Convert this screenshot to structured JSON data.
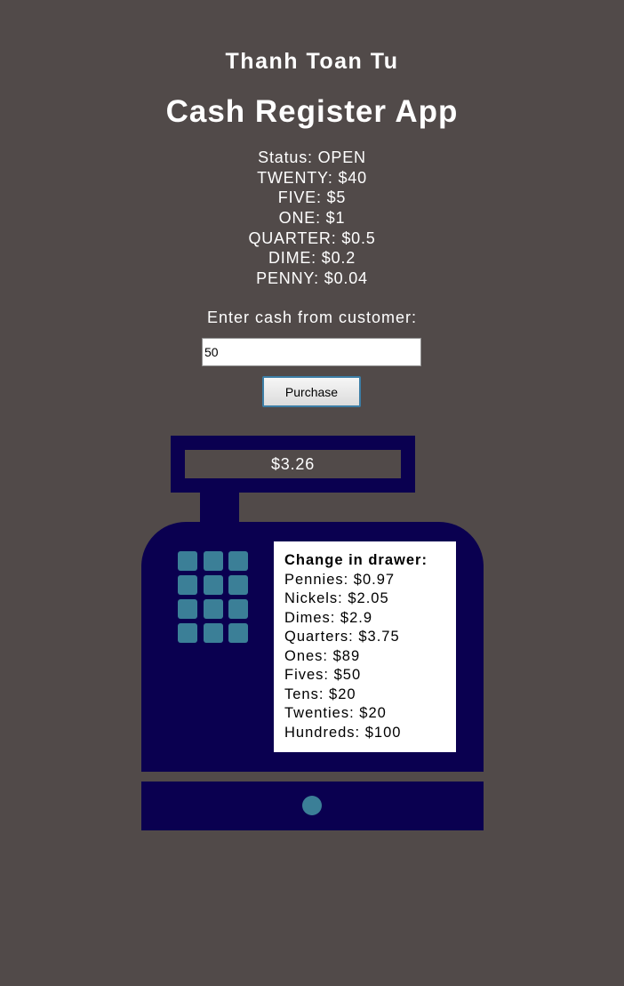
{
  "header": {
    "author": "Thanh Toan Tu",
    "title": "Cash Register App"
  },
  "status": {
    "lines": [
      "Status: OPEN",
      "TWENTY: $40",
      "FIVE: $5",
      "ONE: $1",
      "QUARTER: $0.5",
      "DIME: $0.2",
      "PENNY: $0.04"
    ]
  },
  "form": {
    "label": "Enter cash from customer:",
    "cash_value": "50",
    "purchase_label": "Purchase"
  },
  "register": {
    "price_display": "$3.26",
    "drawer": {
      "heading": "Change in drawer:",
      "lines": [
        "Pennies: $0.97",
        "Nickels: $2.05",
        "Dimes: $2.9",
        "Quarters: $3.75",
        "Ones: $89",
        "Fives: $50",
        "Tens: $20",
        "Twenties: $20",
        "Hundreds: $100"
      ]
    }
  },
  "colors": {
    "background": "#514a49",
    "register": "#0a0050",
    "accent": "#3b7f97"
  }
}
